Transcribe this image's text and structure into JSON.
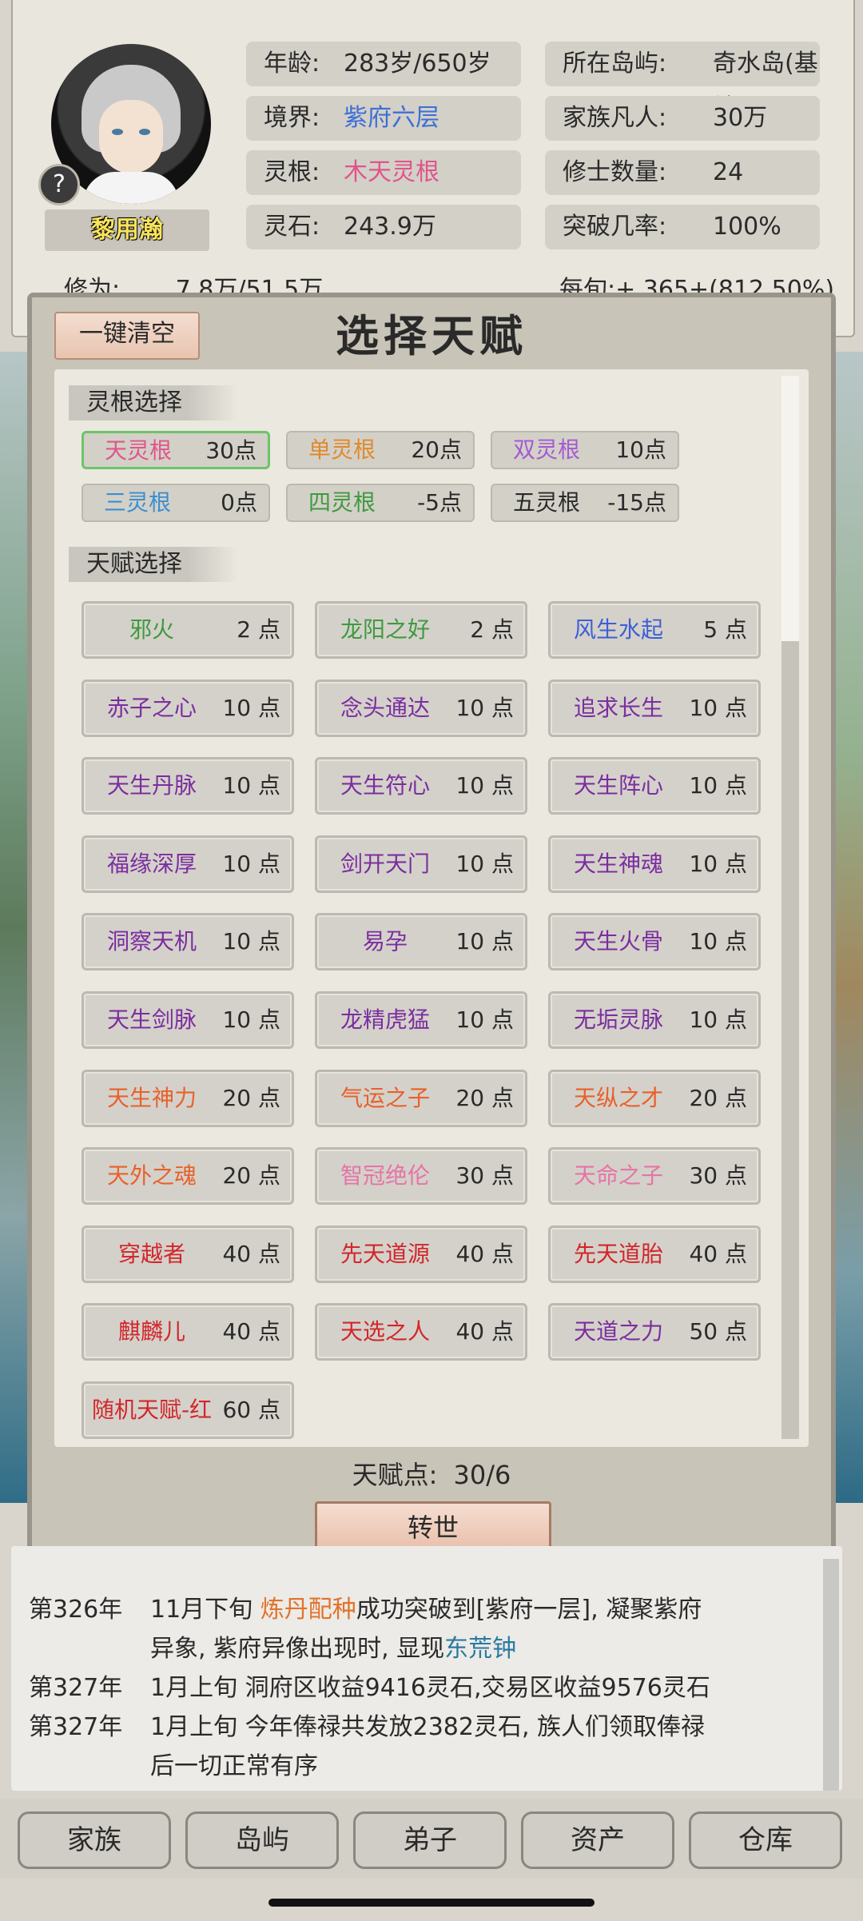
{
  "character": {
    "name": "黎用瀚",
    "stats_left": [
      {
        "label": "年龄:",
        "value": "283岁/650岁",
        "color": "#2a2a2a"
      },
      {
        "label": "境界:",
        "value": "紫府六层",
        "color": "#3d6fd6"
      },
      {
        "label": "灵根:",
        "value": "木天灵根",
        "color": "#e0558b"
      },
      {
        "label": "灵石:",
        "value": "243.9万",
        "color": "#2a2a2a"
      }
    ],
    "stats_right": [
      {
        "label": "所在岛屿:",
        "value": "奇水岛(基地)",
        "color": "#2a2a2a"
      },
      {
        "label": "家族凡人:",
        "value": "30万",
        "color": "#2a2a2a"
      },
      {
        "label": "修士数量:",
        "value": "24",
        "color": "#2a2a2a"
      },
      {
        "label": "突破几率:",
        "value": "100%",
        "color": "#2a2a2a"
      }
    ],
    "cultivation_label": "修为:",
    "cultivation_value": "7.8万/51.5万",
    "per_period": "每旬:+ 365+(812.50%)"
  },
  "modal": {
    "clear_button": "一键清空",
    "title": "选择天赋",
    "root_section_label": "灵根选择",
    "talent_section_label": "天赋选择",
    "points_label": "天赋点:",
    "points_value": "30/6",
    "reborn_button": "转世",
    "roots": [
      {
        "name": "天灵根",
        "points": "30点",
        "color": "#e0558b",
        "selected": true
      },
      {
        "name": "单灵根",
        "points": "20点",
        "color": "#e08a2b",
        "selected": false
      },
      {
        "name": "双灵根",
        "points": "10点",
        "color": "#a55bd0",
        "selected": false
      },
      {
        "name": "三灵根",
        "points": "0点",
        "color": "#3b8fd0",
        "selected": false
      },
      {
        "name": "四灵根",
        "points": "-5点",
        "color": "#3f9a3f",
        "selected": false
      },
      {
        "name": "五灵根",
        "points": "-15点",
        "color": "#2a2a2a",
        "selected": false
      }
    ],
    "talents": [
      {
        "name": "邪火",
        "points": "2 点",
        "color": "#3f9a3f"
      },
      {
        "name": "龙阳之好",
        "points": "2 点",
        "color": "#3f9a3f"
      },
      {
        "name": "风生水起",
        "points": "5 点",
        "color": "#3d5fd6"
      },
      {
        "name": "赤子之心",
        "points": "10 点",
        "color": "#7b2ea0"
      },
      {
        "name": "念头通达",
        "points": "10 点",
        "color": "#7b2ea0"
      },
      {
        "name": "追求长生",
        "points": "10 点",
        "color": "#7b2ea0"
      },
      {
        "name": "天生丹脉",
        "points": "10 点",
        "color": "#7b2ea0"
      },
      {
        "name": "天生符心",
        "points": "10 点",
        "color": "#7b2ea0"
      },
      {
        "name": "天生阵心",
        "points": "10 点",
        "color": "#7b2ea0"
      },
      {
        "name": "福缘深厚",
        "points": "10 点",
        "color": "#7b2ea0"
      },
      {
        "name": "剑开天门",
        "points": "10 点",
        "color": "#7b2ea0"
      },
      {
        "name": "天生神魂",
        "points": "10 点",
        "color": "#7b2ea0"
      },
      {
        "name": "洞察天机",
        "points": "10 点",
        "color": "#7b2ea0"
      },
      {
        "name": "易孕",
        "points": "10 点",
        "color": "#7b2ea0"
      },
      {
        "name": "天生火骨",
        "points": "10 点",
        "color": "#7b2ea0"
      },
      {
        "name": "天生剑脉",
        "points": "10 点",
        "color": "#7b2ea0"
      },
      {
        "name": "龙精虎猛",
        "points": "10 点",
        "color": "#7b2ea0"
      },
      {
        "name": "无垢灵脉",
        "points": "10 点",
        "color": "#7b2ea0"
      },
      {
        "name": "天生神力",
        "points": "20 点",
        "color": "#e8612b"
      },
      {
        "name": "气运之子",
        "points": "20 点",
        "color": "#e8612b"
      },
      {
        "name": "天纵之才",
        "points": "20 点",
        "color": "#e8612b"
      },
      {
        "name": "天外之魂",
        "points": "20 点",
        "color": "#e8612b"
      },
      {
        "name": "智冠绝伦",
        "points": "30 点",
        "color": "#e574a6"
      },
      {
        "name": "天命之子",
        "points": "30 点",
        "color": "#e574a6"
      },
      {
        "name": "穿越者",
        "points": "40 点",
        "color": "#d2262b"
      },
      {
        "name": "先天道源",
        "points": "40 点",
        "color": "#d2262b"
      },
      {
        "name": "先天道胎",
        "points": "40 点",
        "color": "#d2262b"
      },
      {
        "name": "麒麟儿",
        "points": "40 点",
        "color": "#d2262b"
      },
      {
        "name": "天选之人",
        "points": "40 点",
        "color": "#d2262b"
      },
      {
        "name": "天道之力",
        "points": "50 点",
        "color": "#7b2ea0"
      },
      {
        "name": "随机天赋-红",
        "points": "60 点",
        "color": "#d2262b"
      }
    ]
  },
  "log": [
    {
      "year": "第326年",
      "parts": [
        "11月下旬 ",
        "炼丹配种",
        "成功突破到[紫府一层], 凝聚紫府"
      ]
    },
    {
      "year": "",
      "parts": [
        "异象, 紫府异像出现时, 显现",
        "东荒钟",
        ""
      ]
    },
    {
      "year": "第327年",
      "parts": [
        "1月上旬 洞府区收益9416灵石,交易区收益9576灵石",
        "",
        ""
      ]
    },
    {
      "year": "第327年",
      "parts": [
        "1月上旬 今年俸禄共发放2382灵石, 族人们领取俸禄",
        "",
        ""
      ]
    },
    {
      "year": "",
      "parts": [
        "后一切正常有序",
        "",
        ""
      ]
    }
  ],
  "nav": [
    "家族",
    "岛屿",
    "弟子",
    "资产",
    "仓库"
  ]
}
